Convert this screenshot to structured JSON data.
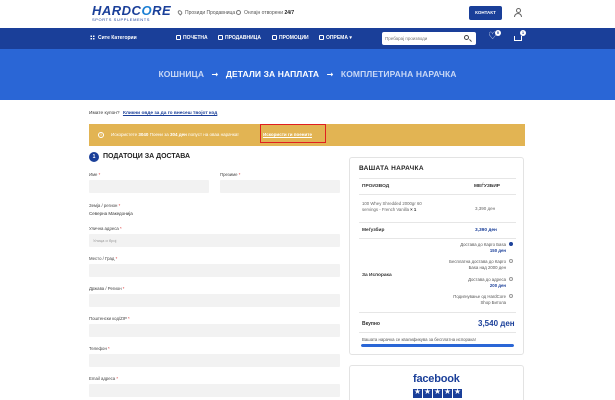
{
  "brand": {
    "logo_main_1": "HARDC",
    "logo_main_o": "O",
    "logo_main_2": "RE",
    "logo_sub": "SPORTS SUPPLEMENTS",
    "primary_color": "#1a3f99",
    "accent_color": "#2a66d6",
    "notice_color": "#e2b453"
  },
  "topbar": {
    "location": "Проѕиди Продавница",
    "hours_label": "Онлајн отворени",
    "hours_value": "24/7",
    "contact_button": "КОНТАКТ"
  },
  "nav": {
    "categories": "Сите Категории",
    "items": [
      {
        "label": "ПОЧЕТНА"
      },
      {
        "label": "ПРОДАВНИЦА"
      },
      {
        "label": "ПРОМОЦИИ"
      },
      {
        "label": "ОПРЕМА"
      }
    ],
    "search_placeholder": "Пребарај производи",
    "wishlist_count": "0",
    "cart_count": "1"
  },
  "steps": {
    "step1": "КОШНИЦА",
    "arrow": "→",
    "step2": "ДЕТАЛИ ЗА НАПЛАТА",
    "step3": "КОМПЛЕТИРАНА НАРАЧКА"
  },
  "coupon": {
    "question": "Имате купон?",
    "link": "Кликни овде за да го внесеш твојот код"
  },
  "notice": {
    "icon": "!",
    "prefix": "Искористете",
    "points": "3040",
    "middle": "Поени за",
    "amount": "304 ден",
    "suffix": "попуст на оваа нарачка!",
    "link": "Искористи ги поените"
  },
  "form": {
    "step_number": "1",
    "title": "ПОДАТОЦИ ЗА ДОСТАВА",
    "first_name": "Име",
    "last_name": "Презиме",
    "country_label": "Земја / регион",
    "country_value": "Северна Македонија",
    "street_label": "Улична адреса",
    "street_placeholder": "Улица и број",
    "city_label": "Место / Град",
    "state_label": "Држава / Регион",
    "zip_label": "Поштенски код/ZIP",
    "phone_label": "Телефон",
    "email_label": "Email адреса",
    "required_mark": "*"
  },
  "order": {
    "title": "ВАШАТА НАРАЧКА",
    "col_product": "ПРОИЗВОД",
    "col_subtotal": "МЕЃУЗБИР",
    "product_line1": "100 Whey Shredded 2000gr 60",
    "product_line2": "servings - French Vanilla",
    "product_qty": "× 1",
    "product_price": "3,390 ден",
    "subtotal_label": "Меѓузбир",
    "subtotal_value": "3,390 ден",
    "shipping_label": "За Испорака",
    "shipping_options": [
      {
        "line1": "Достава до Карго Баѕа",
        "line2": "",
        "price": "150 ден",
        "selected": true
      },
      {
        "line1": "Бесплатна достава до Карго",
        "line2": "Баѕа над 2000 ден",
        "price": "",
        "selected": false
      },
      {
        "line1": "Достава до адреса",
        "line2": "",
        "price": "200 ден",
        "selected": false
      },
      {
        "line1": "Подигнување од HardCore",
        "line2": "Shop Битола",
        "price": "",
        "selected": false
      }
    ],
    "total_label": "Вкупно",
    "total_value": "3,540 ден",
    "free_shipping_note": "Вашата нарачка се квалификува за бесплатна испорака!",
    "free_shipping_progress": 1.0
  },
  "facebook": {
    "logo_text": "facebook",
    "rating": 5
  }
}
